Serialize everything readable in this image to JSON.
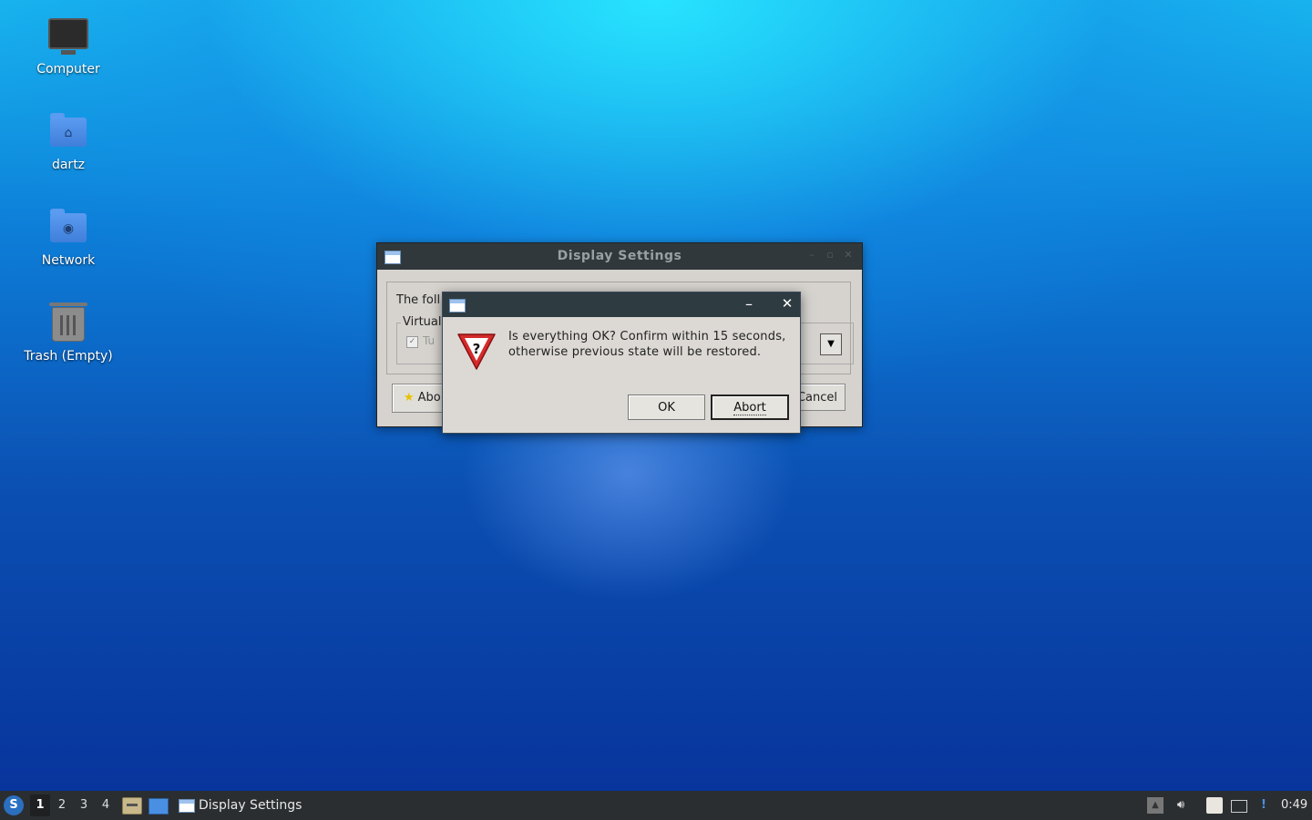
{
  "desktop": {
    "icons": [
      {
        "label": "Computer",
        "icon": "computer-icon"
      },
      {
        "label": "dartz",
        "icon": "home-folder-icon"
      },
      {
        "label": "Network",
        "icon": "network-folder-icon"
      },
      {
        "label": "Trash (Empty)",
        "icon": "trash-icon"
      }
    ]
  },
  "display_settings": {
    "title": "Display Settings",
    "intro_text": "The foll",
    "group_label": "Virtual",
    "checkbox_label": "Tu",
    "about_label": "Abo",
    "cancel_label": "Cancel"
  },
  "dialog": {
    "message_line1": "Is everything OK? Confirm within 15 seconds,",
    "message_line2": "otherwise previous state will be restored.",
    "minimize_glyph": "–",
    "close_glyph": "✕",
    "icon_symbol": "?",
    "ok_label": "OK",
    "abort_label": "Abort"
  },
  "taskbar": {
    "workspaces": [
      "1",
      "2",
      "3",
      "4"
    ],
    "active_workspace": "1",
    "task_label": "Display Settings",
    "clock": "0:49"
  },
  "colors": {
    "titlebar": "#2e3b41",
    "dialog_bg": "#dcd9d4",
    "taskbar": "#2b2e31",
    "warning_red": "#d42b2b"
  }
}
